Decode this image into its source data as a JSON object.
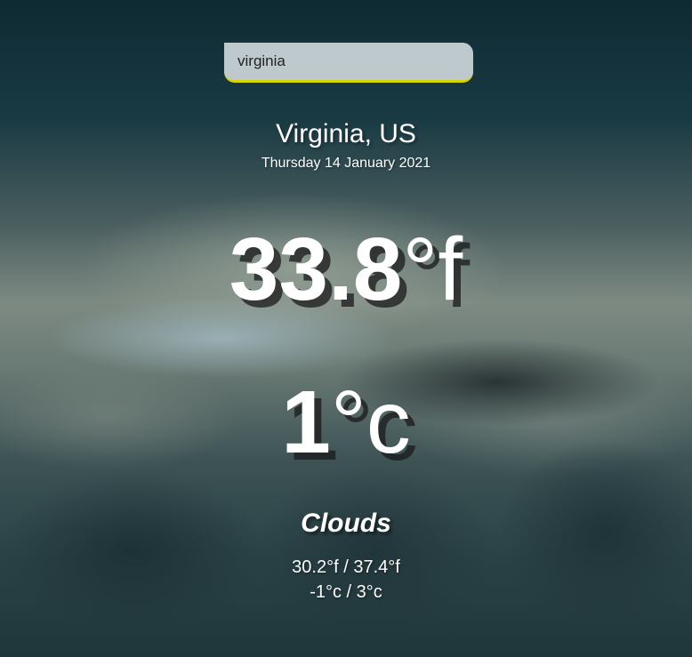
{
  "search": {
    "value": "virginia"
  },
  "location": {
    "name": "Virginia, US",
    "date": "Thursday 14 January 2021"
  },
  "temperature": {
    "fahrenheit_value": "33.8",
    "fahrenheit_unit": "°f",
    "celsius_value": "1",
    "celsius_unit": "°c"
  },
  "condition": "Clouds",
  "range": {
    "fahrenheit": "30.2°f / 37.4°f",
    "celsius": "-1°c / 3°c"
  },
  "colors": {
    "search_underline": "#d8d400"
  }
}
